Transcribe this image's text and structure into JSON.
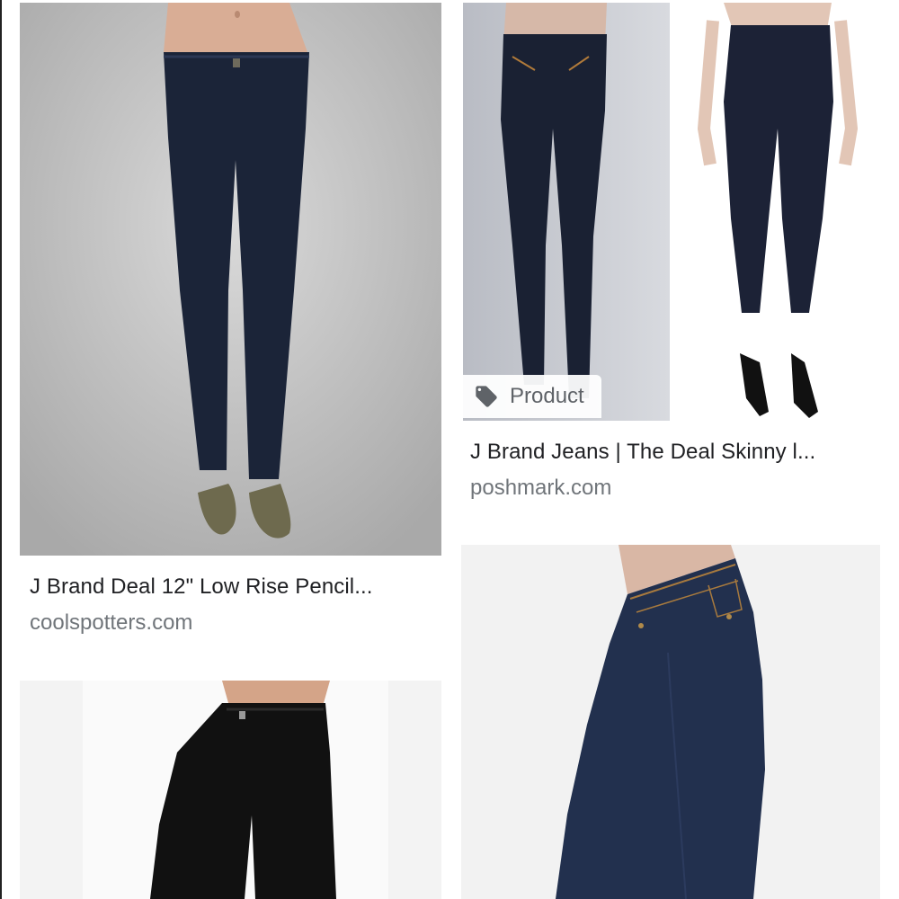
{
  "results": [
    {
      "title": "J Brand Deal 12\" Low Rise Pencil...",
      "source": "coolspotters.com"
    },
    {
      "title": "J Brand Jeans | The Deal Skinny l...",
      "source": "poshmark.com",
      "badge": {
        "icon": "tag-icon",
        "label": "Product"
      }
    }
  ],
  "colors": {
    "title": "#202124",
    "source": "#70757a",
    "badge_text": "#5f6368",
    "denim_dark": "#1a2236",
    "denim_navy": "#1f2b45"
  }
}
